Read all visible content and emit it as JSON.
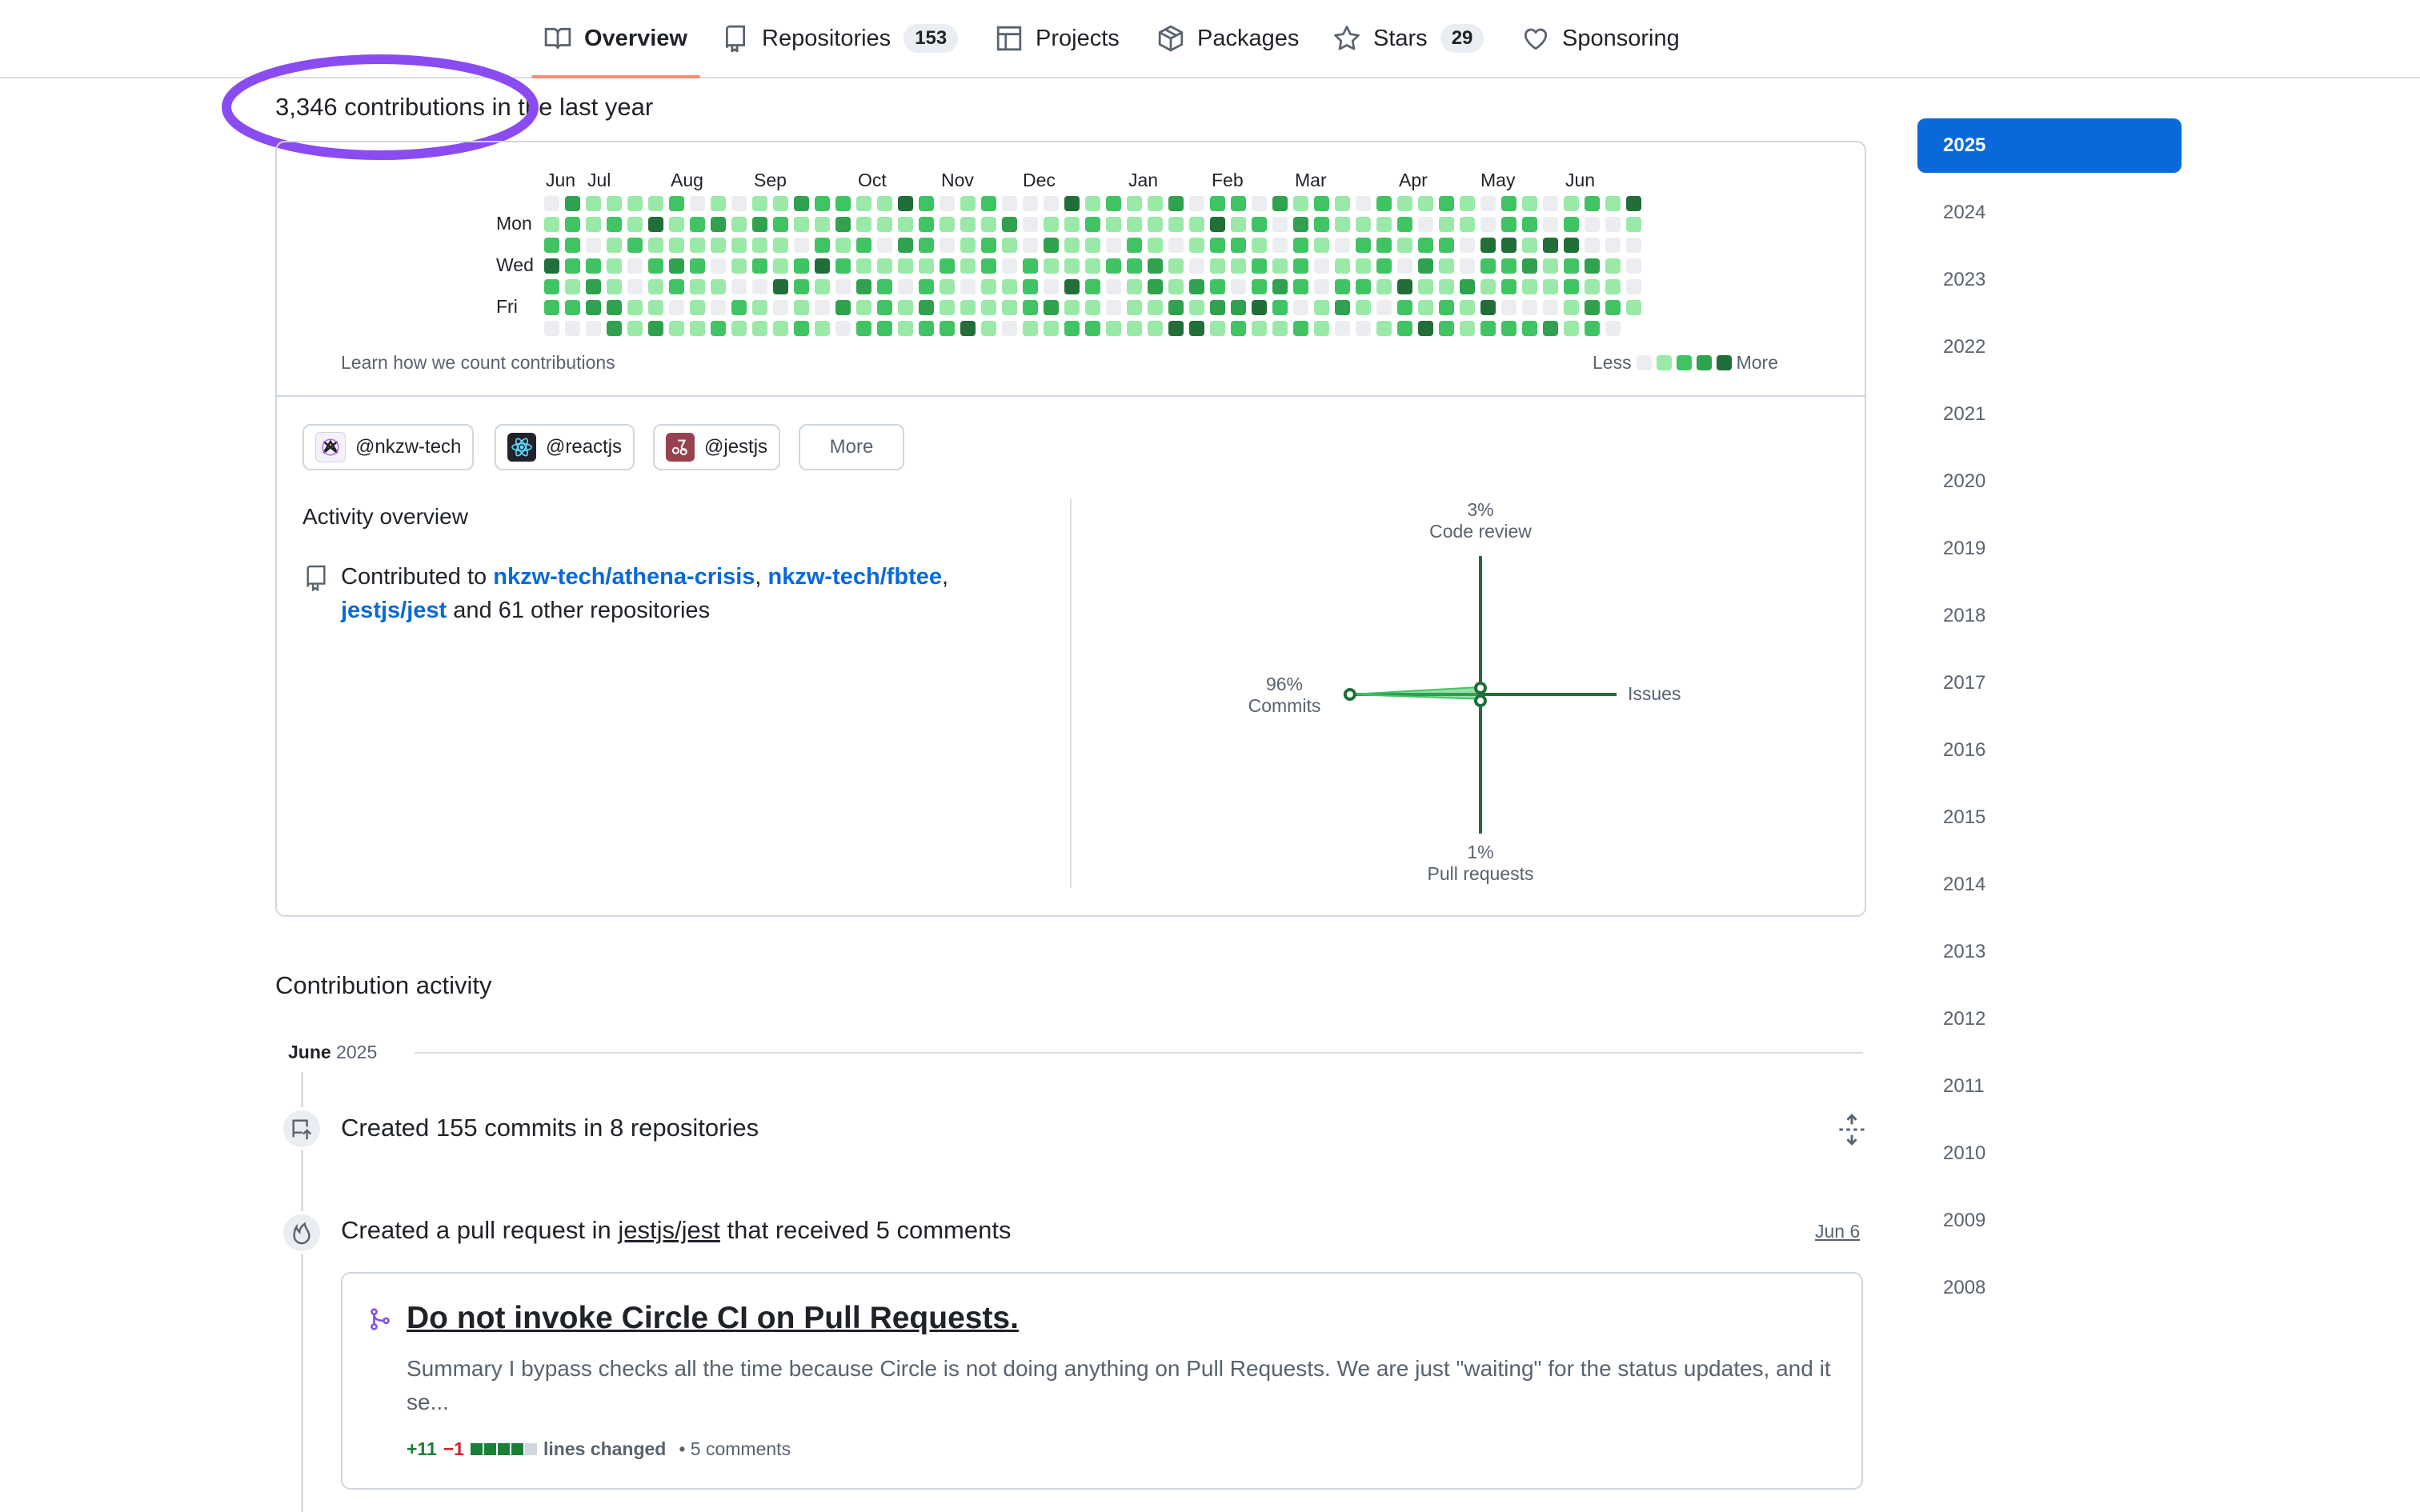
{
  "nav": {
    "tabs": [
      {
        "label": "Overview",
        "icon": "book-icon",
        "selected": true
      },
      {
        "label": "Repositories",
        "icon": "repo-icon",
        "count": "153"
      },
      {
        "label": "Projects",
        "icon": "table-icon"
      },
      {
        "label": "Packages",
        "icon": "package-icon"
      },
      {
        "label": "Stars",
        "icon": "star-icon",
        "count": "29"
      },
      {
        "label": "Sponsoring",
        "icon": "heart-icon"
      }
    ]
  },
  "contributions": {
    "title": "3,346 contributions in the last year",
    "months": [
      "Jun",
      "Jul",
      "Aug",
      "Sep",
      "Oct",
      "Nov",
      "Dec",
      "Jan",
      "Feb",
      "Mar",
      "Apr",
      "May",
      "Jun"
    ],
    "days": [
      "Mon",
      "Wed",
      "Fri"
    ],
    "learn_link": "Learn how we count contributions",
    "legend_less": "Less",
    "legend_more": "More",
    "colors": {
      "level0": "#ebedf0",
      "level1": "#9be9a8",
      "level2": "#40c463",
      "level3": "#30a14e",
      "level4": "#216e39"
    }
  },
  "orgs": [
    {
      "label": "@nkzw-tech",
      "icon": "nkzw-logo-icon"
    },
    {
      "label": "@reactjs",
      "icon": "react-logo-icon"
    },
    {
      "label": "@jestjs",
      "icon": "jest-logo-icon"
    }
  ],
  "orgs_more": "More",
  "activity": {
    "title": "Activity overview",
    "contributed_prefix": "Contributed to",
    "repo1": "nkzw-tech/athena-crisis",
    "sep1": ",",
    "repo2": "nkzw-tech/fbtee",
    "sep2": ",",
    "repo3": "jestjs/jest",
    "suffix": "and 61 other repositories"
  },
  "radar": {
    "code_review_pct": "3%",
    "code_review_label": "Code review",
    "commits_pct": "96%",
    "commits_label": "Commits",
    "issues_label": "Issues",
    "pr_pct": "1%",
    "pr_label": "Pull requests",
    "values": {
      "code_review": 3,
      "commits": 96,
      "issues": 0,
      "pull_requests": 1
    }
  },
  "contribution_activity": {
    "title": "Contribution activity",
    "month": "June",
    "year": "2025",
    "commits_text": "Created 155 commits in 8 repositories",
    "pr_prefix": "Created a pull request in",
    "pr_repo": "jestjs/jest",
    "pr_suffix": "that received 5 comments",
    "pr_date": "Jun 6",
    "pr_title": "Do not invoke Circle CI on Pull Requests.",
    "pr_summary": "Summary I bypass checks all the time because Circle is not doing anything on Pull Requests. We are just \"waiting\" for the status updates, and it se...",
    "additions": "+11",
    "deletions": "−1",
    "lines_changed": "lines changed",
    "comments": "• 5 comments"
  },
  "years": [
    "2025",
    "2024",
    "2023",
    "2022",
    "2021",
    "2020",
    "2019",
    "2018",
    "2017",
    "2016",
    "2015",
    "2014",
    "2013",
    "2012",
    "2011",
    "2010",
    "2009",
    "2008"
  ],
  "selected_year": "2025"
}
